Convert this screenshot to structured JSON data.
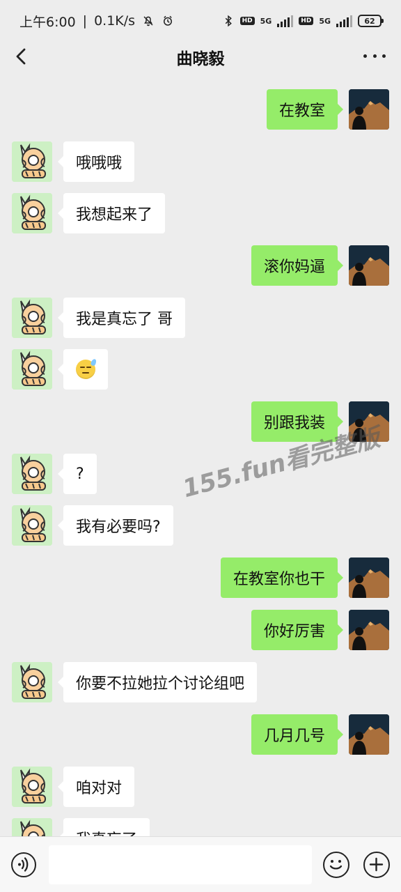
{
  "status_bar": {
    "time": "上午6:00",
    "network_speed": "0.1K/s",
    "hd_label": "HD",
    "network_type": "5G",
    "battery": "62"
  },
  "header": {
    "title": "曲晓毅",
    "back_icon": "back-arrow-icon",
    "more_icon": "more-icon"
  },
  "messages": [
    {
      "side": "outgoing",
      "text": "在教室"
    },
    {
      "side": "incoming",
      "text": "哦哦哦"
    },
    {
      "side": "incoming",
      "text": "我想起来了"
    },
    {
      "side": "outgoing",
      "text": "滚你妈逼"
    },
    {
      "side": "incoming",
      "text": "我是真忘了 哥"
    },
    {
      "side": "incoming",
      "text": "😓"
    },
    {
      "side": "outgoing",
      "text": "别跟我装"
    },
    {
      "side": "incoming",
      "text": "?"
    },
    {
      "side": "incoming",
      "text": "我有必要吗?"
    },
    {
      "side": "outgoing",
      "text": "在教室你也干"
    },
    {
      "side": "outgoing",
      "text": "你好厉害"
    },
    {
      "side": "incoming",
      "text": "你要不拉她拉个讨论组吧"
    },
    {
      "side": "outgoing",
      "text": "几月几号"
    },
    {
      "side": "incoming",
      "text": "咱对对"
    },
    {
      "side": "incoming",
      "text": "我真忘了"
    }
  ],
  "watermark": "155.fun看完整版",
  "input_bar": {
    "voice_icon": "voice-icon",
    "emoji_icon": "emoji-icon",
    "plus_icon": "plus-icon"
  },
  "colors": {
    "background": "#ededed",
    "outgoing_bubble": "#95ec69",
    "incoming_bubble": "#ffffff",
    "input_bar": "#f7f7f7"
  }
}
